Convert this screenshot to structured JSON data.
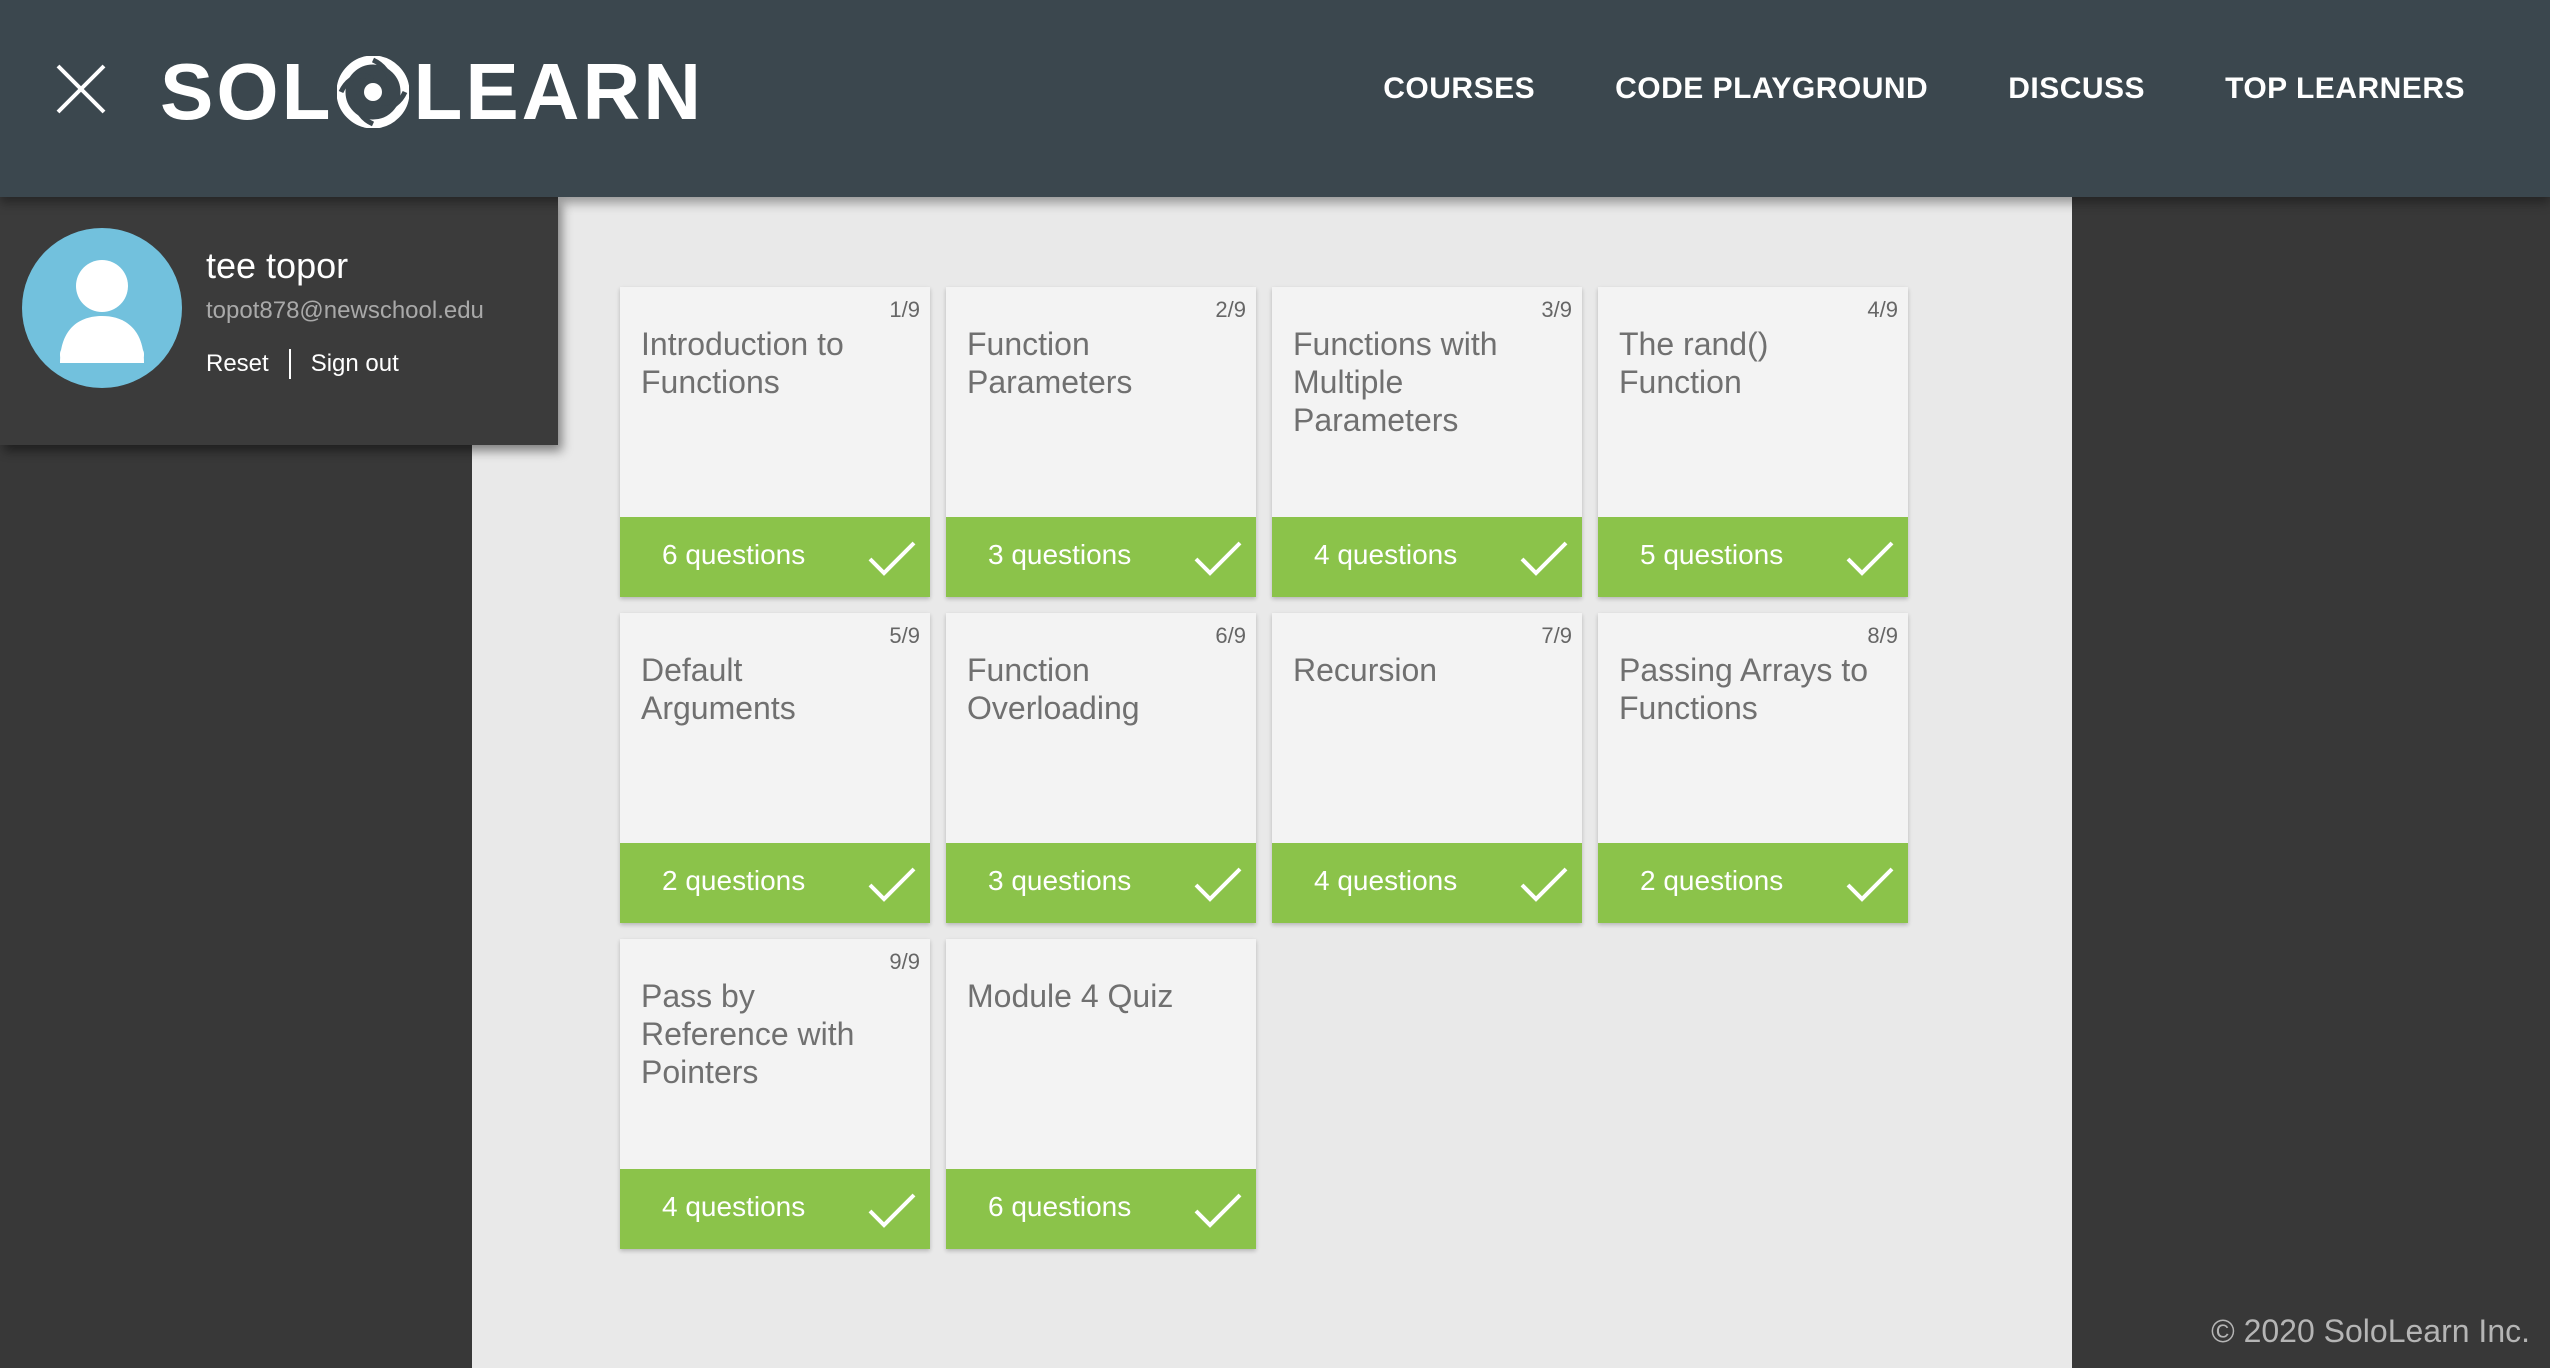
{
  "header": {
    "logo_left": "SOL",
    "logo_right": "LEARN",
    "nav": [
      {
        "label": "COURSES"
      },
      {
        "label": "CODE PLAYGROUND"
      },
      {
        "label": "DISCUSS"
      },
      {
        "label": "TOP LEARNERS"
      }
    ]
  },
  "profile": {
    "name": "tee topor",
    "email": "topot878@newschool.edu",
    "reset_label": "Reset",
    "signout_label": "Sign out"
  },
  "lessons": [
    {
      "num": "1/9",
      "title": "Introduction to Functions",
      "questions": "6 questions"
    },
    {
      "num": "2/9",
      "title": "Function Parameters",
      "questions": "3 questions"
    },
    {
      "num": "3/9",
      "title": "Functions with Multiple Parameters",
      "questions": "4 questions"
    },
    {
      "num": "4/9",
      "title": "The rand() Function",
      "questions": "5 questions"
    },
    {
      "num": "5/9",
      "title": "Default Arguments",
      "questions": "2 questions"
    },
    {
      "num": "6/9",
      "title": "Function Overloading",
      "questions": "3 questions"
    },
    {
      "num": "7/9",
      "title": "Recursion",
      "questions": "4 questions"
    },
    {
      "num": "8/9",
      "title": "Passing Arrays to Functions",
      "questions": "2 questions"
    },
    {
      "num": "9/9",
      "title": "Pass by Reference with Pointers",
      "questions": "4 questions"
    },
    {
      "num": "",
      "title": "Module 4 Quiz",
      "questions": "6 questions"
    }
  ],
  "colors": {
    "header_bg": "#3b474e",
    "completed_green": "#8bc34a",
    "avatar_blue": "#72c1dd"
  },
  "footer": {
    "copyright": "© 2020 SoloLearn Inc."
  }
}
